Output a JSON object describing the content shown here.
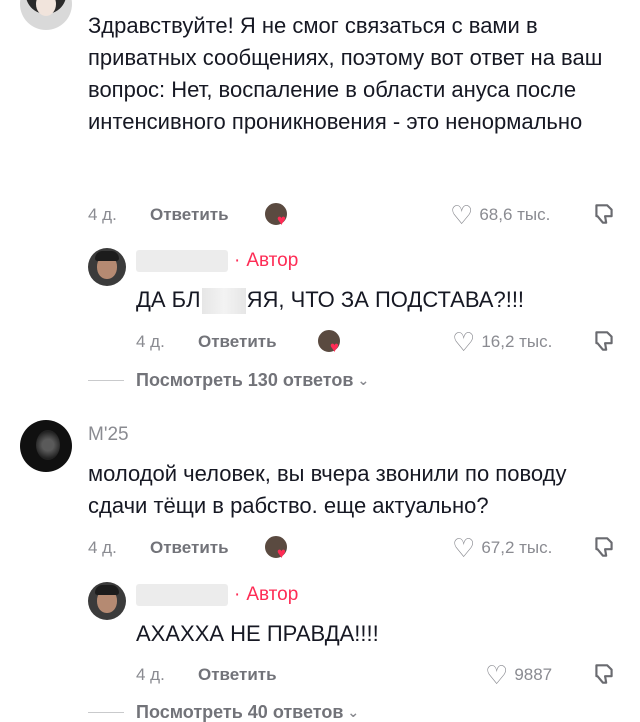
{
  "comments": [
    {
      "text": "Здравствуйте! Я не смог связаться с вами в приватных сообщениях, поэтому вот ответ на ваш вопрос: Нет, воспаление в области ануса после интенсивного проникновения - это ненормально",
      "date": "4 д.",
      "reply_label": "Ответить",
      "likes": "68,6 тыс.",
      "reply": {
        "author_badge": "Автор",
        "text_prefix": "ДА БЛ",
        "text_suffix": "ЯЯ, ЧТО ЗА ПОДСТАВА?!!!",
        "date": "4 д.",
        "reply_label": "Ответить",
        "likes": "16,2 тыс."
      },
      "view_replies": "Посмотреть 130 ответов"
    },
    {
      "username": "M'25",
      "text": "молодой человек, вы вчера звонили по поводу сдачи тёщи в рабство. еще актуально?",
      "date": "4 д.",
      "reply_label": "Ответить",
      "likes": "67,2 тыс.",
      "reply": {
        "author_badge": "Автор",
        "text": "АХАХХА НЕ ПРАВДА!!!!",
        "date": "4 д.",
        "reply_label": "Ответить",
        "likes": "9887"
      },
      "view_replies": "Посмотреть 40 ответов"
    }
  ],
  "icons": {
    "heart_outline": "heart-outline-icon",
    "dislike": "thumbs-down-icon",
    "liked_by_creator": "creator-liked-avatar-icon",
    "chevron": "chevron-down-icon"
  },
  "colors": {
    "accent": "#fe2c55",
    "meta": "#8a8b91",
    "text": "#161823"
  }
}
